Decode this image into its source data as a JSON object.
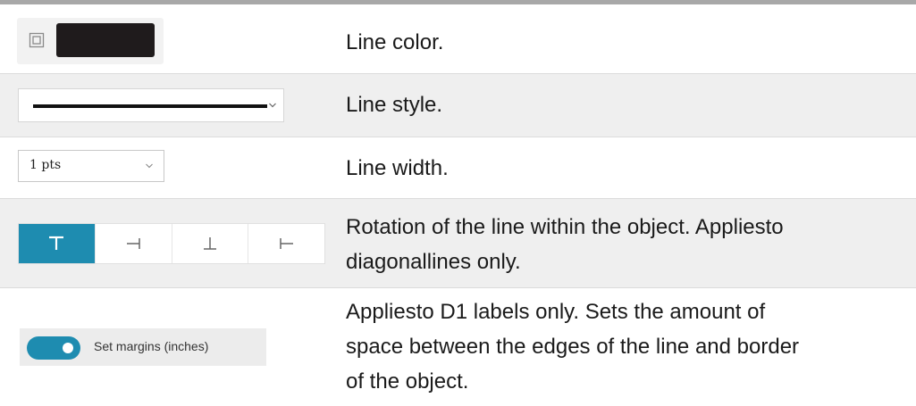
{
  "rows": [
    {
      "control": "color-picker",
      "color_value": "#1f1b1c",
      "icon": "border-square-icon",
      "description": "Line color."
    },
    {
      "control": "line-style-select",
      "selected_style": "solid",
      "icon": "chevron-down-icon",
      "description": "Line style."
    },
    {
      "control": "line-width-select",
      "value": "1 pts",
      "icon": "chevron-down-icon",
      "description": "Line width."
    },
    {
      "control": "rotation-segmented",
      "buttons": [
        {
          "icon": "top-line-icon",
          "active": true
        },
        {
          "icon": "right-line-icon",
          "active": false
        },
        {
          "icon": "bottom-line-icon",
          "active": false
        },
        {
          "icon": "left-line-icon",
          "active": false
        }
      ],
      "description_lines": [
        "Rotation of the line within the object. Appliesto",
        "diagonallines only."
      ]
    },
    {
      "control": "margins-toggle",
      "toggle_on": true,
      "label": "Set margins (inches)",
      "description_lines": [
        "Appliesto D1 labels only. Sets the amount of",
        "space between the edges of the line and border",
        "of the object."
      ]
    }
  ],
  "colors": {
    "accent": "#1e8cb0",
    "swatch": "#1f1b1c",
    "shade": "#efefef",
    "rule": "#a8a8a8"
  }
}
